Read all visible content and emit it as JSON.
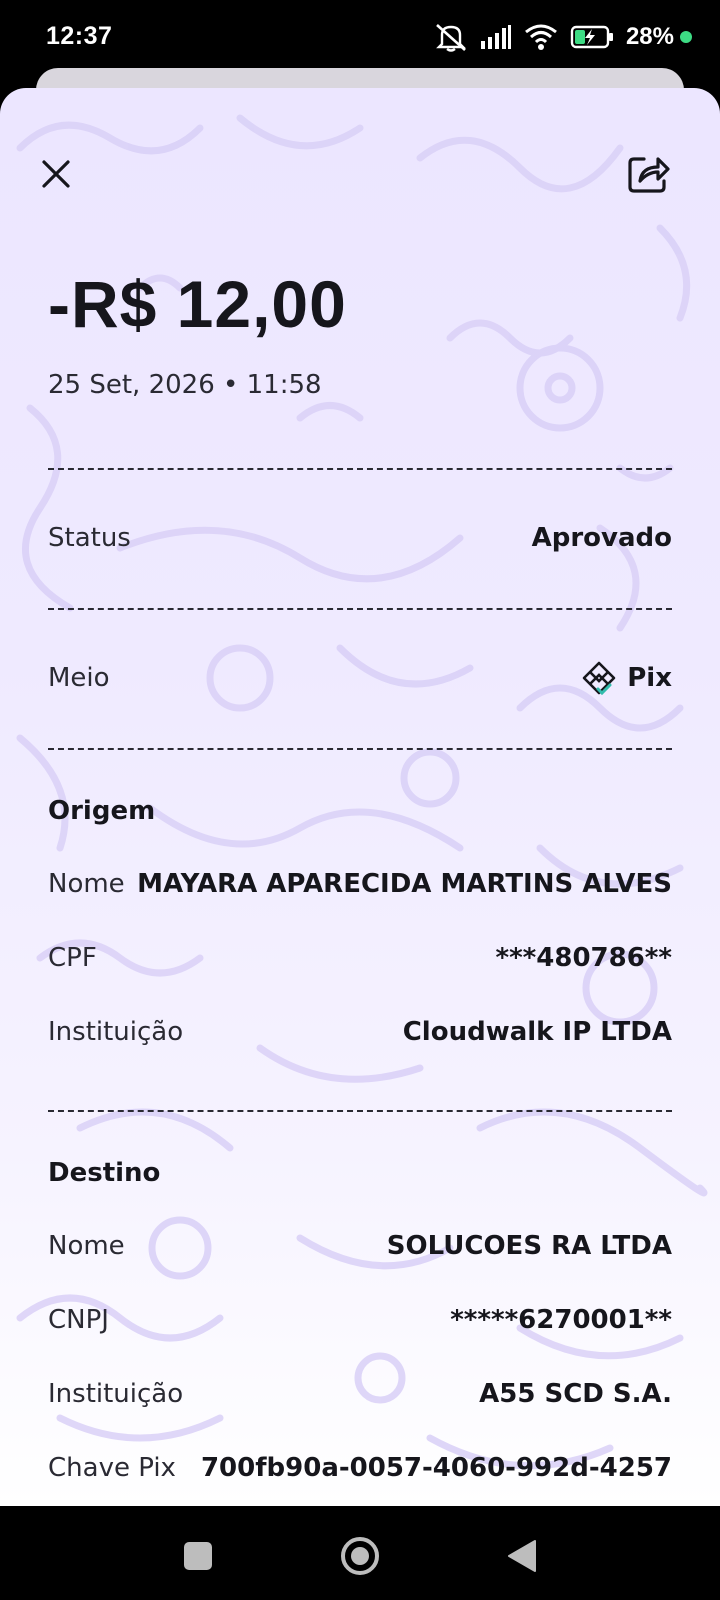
{
  "status_bar": {
    "time": "12:37",
    "battery": "28%",
    "icons": [
      "mute-icon",
      "signal-icon",
      "wifi-icon",
      "battery-charging-icon",
      "notification-dot"
    ]
  },
  "header": {
    "close_icon": "close-icon",
    "share_icon": "share-icon"
  },
  "transaction": {
    "amount": "-R$ 12,00",
    "datetime": "25 Set, 2026 • 11:58",
    "status_label": "Status",
    "status_value": "Aprovado",
    "method_label": "Meio",
    "method_value": "Pix",
    "method_icon": "pix-icon"
  },
  "origin": {
    "title": "Origem",
    "name_label": "Nome",
    "name_value": "MAYARA APARECIDA MARTINS ALVES",
    "doc_label": "CPF",
    "doc_value": "***480786**",
    "inst_label": "Instituição",
    "inst_value": "Cloudwalk IP LTDA"
  },
  "destination": {
    "title": "Destino",
    "name_label": "Nome",
    "name_value": "SOLUCOES RA LTDA",
    "doc_label": "CNPJ",
    "doc_value": "*****6270001**",
    "inst_label": "Instituição",
    "inst_value": "A55 SCD S.A.",
    "key_label": "Chave Pix",
    "key_value": "700fb90a-0057-4060-992d-4257"
  },
  "nav": {
    "icons": [
      "recents-square-icon",
      "home-circle-icon",
      "back-triangle-icon"
    ]
  },
  "colors": {
    "sheet_bg": "#ece6ff",
    "pattern": "#d9d0f7",
    "text": "#16161c",
    "pix_accent": "#32bcad"
  }
}
